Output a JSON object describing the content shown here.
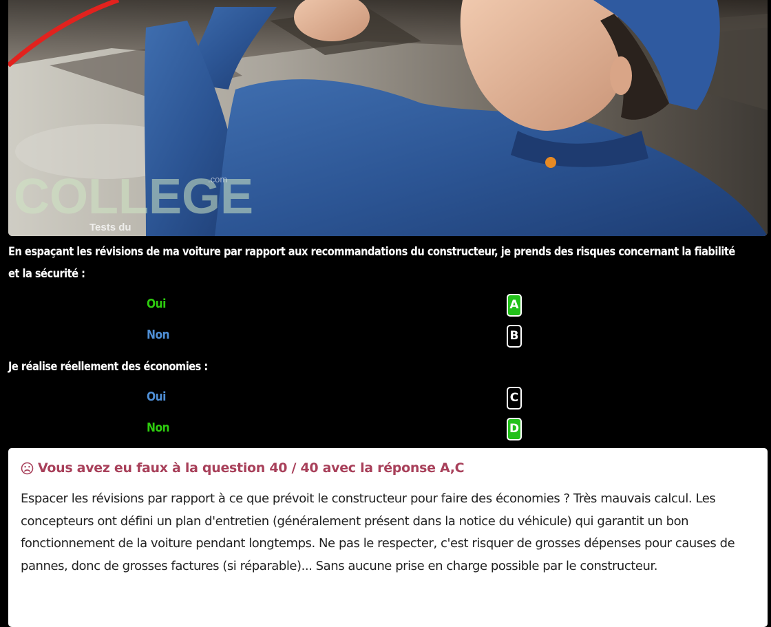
{
  "hero": {
    "watermark_text": "Tests du",
    "watermark_domain": ".com"
  },
  "questions": [
    {
      "text": "En espaçant les révisions de ma voiture par rapport aux recommandations du constructeur, je prends des risques concernant la fiabilité et la sécurité :",
      "options": [
        {
          "label": "Oui",
          "letter": "A",
          "status": "correct"
        },
        {
          "label": "Non",
          "letter": "B",
          "status": "neutral"
        }
      ]
    },
    {
      "text": "Je réalise réellement des économies :",
      "options": [
        {
          "label": "Oui",
          "letter": "C",
          "status": "neutral"
        },
        {
          "label": "Non",
          "letter": "D",
          "status": "correct"
        }
      ]
    }
  ],
  "feedback": {
    "icon": "sad-face-icon",
    "title": "Vous avez eu faux à la question 40 / 40 avec la réponse A,C",
    "body": "Espacer les révisions par rapport à ce que prévoit le constructeur pour faire des économies ? Très mauvais calcul. Les concepteurs ont défini un plan d'entretien (généralement présent dans la notice du véhicule) qui garantit un bon fonctionnement de la voiture pendant longtemps. Ne pas le respecter, c'est risquer de grosses dépenses pour causes de pannes, donc de grosses factures (si réparable)... Sans aucune prise en charge possible par le constructeur."
  },
  "colors": {
    "page_background": "#000000",
    "correct": "#2ecc0f",
    "correct_box": "#22c01a",
    "neutral": "#4f8fd6",
    "feedback_title": "#a8405a",
    "feedback_background": "#ffffff"
  }
}
